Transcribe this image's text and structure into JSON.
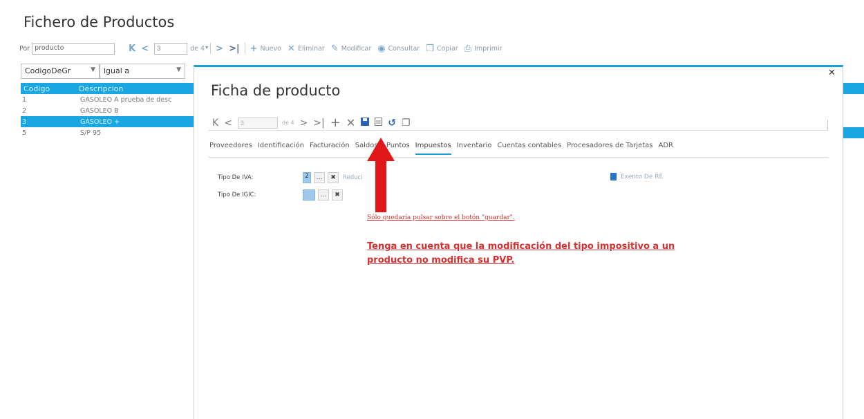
{
  "background": {
    "title": "Fichero de Productos",
    "toolbar": {
      "sort_label": "Por",
      "sort_value": "producto",
      "page_value": "3",
      "page_of": "de 4",
      "new_label": "Nuevo",
      "delete_label": "Eliminar",
      "modify_label": "Modificar",
      "consult_label": "Consultar",
      "copy_label": "Copiar",
      "print_label": "Imprimir"
    },
    "filter": {
      "field": "CodigoDeGr",
      "operator": "igual a"
    },
    "table": {
      "headers": [
        "Codigo",
        "Descripcion"
      ],
      "rows": [
        {
          "code": "1",
          "desc": "GASOLEO A prueba de desc"
        },
        {
          "code": "2",
          "desc": "GASOLEO B"
        },
        {
          "code": "3",
          "desc": "GASOLEO +"
        },
        {
          "code": "5",
          "desc": "S/P 95"
        }
      ],
      "selected_index": 2
    }
  },
  "modal": {
    "title": "Ficha de producto",
    "page_value": "3",
    "page_of": "de 4",
    "tabs": [
      {
        "label": "Proveedores"
      },
      {
        "label": "Identificación"
      },
      {
        "label": "Facturación"
      },
      {
        "label": "Saldos y Puntos"
      },
      {
        "label": "Impuestos"
      },
      {
        "label": "Inventario"
      },
      {
        "label": "Cuentas contables"
      },
      {
        "label": "Procesadores de Tarjetas"
      },
      {
        "label": "ADR"
      }
    ],
    "active_tab": "Impuestos",
    "fields": {
      "iva_label": "Tipo De IVA:",
      "iva_code": "2",
      "iva_desc": "Reduci",
      "igic_label": "Tipo De IGIC:",
      "igic_code": ""
    },
    "re_label": "Exento De RE",
    "note_small": "Sólo quedaría pulsar sobre el botón \"guardar\".",
    "note_big": "Tenga en cuenta que la modificación del tipo impositivo a un producto no modifica su PVP."
  },
  "colors": {
    "accent": "#1aa6e3",
    "arrow": "#e01818",
    "note": "#d43030"
  }
}
